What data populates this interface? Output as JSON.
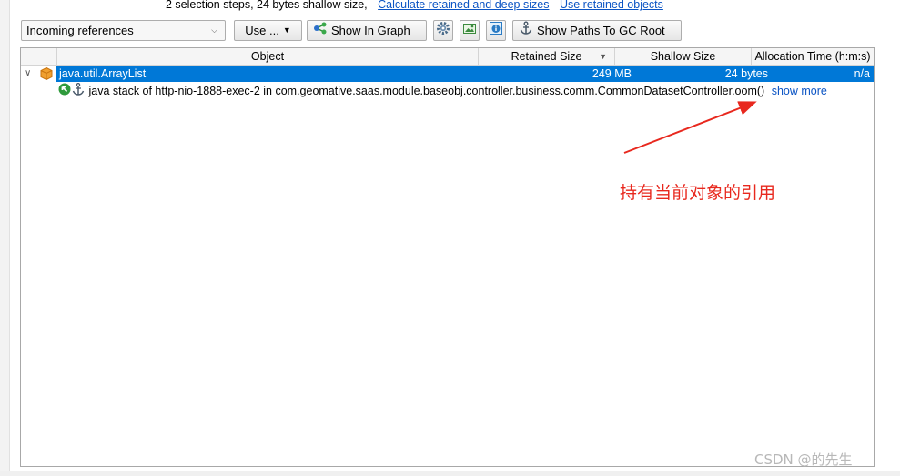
{
  "info": {
    "text": "2 selection steps, 24 bytes shallow size,",
    "link_retained": "Calculate retained and deep sizes",
    "link_objects": "Use retained objects"
  },
  "toolbar": {
    "combo_value": "Incoming references",
    "use_label": "Use ...",
    "graph_label": "Show In Graph",
    "gc_label": "Show Paths To GC Root"
  },
  "table": {
    "columns": {
      "object": "Object",
      "retained": "Retained Size",
      "shallow": "Shallow Size",
      "alloc": "Allocation Time (h:m:s)"
    },
    "root_row": {
      "name": "java.util.ArrayList",
      "retained": "249 MB",
      "shallow": "24 bytes",
      "alloc": "n/a"
    },
    "child_row": {
      "text": "java stack of http-nio-1888-exec-2 in com.geomative.saas.module.baseobj.controller.business.comm.CommonDatasetController.oom()",
      "link": "show more"
    }
  },
  "annotation": {
    "text": "持有当前对象的引用",
    "color": "#e8281e"
  },
  "watermark": {
    "text": "CSDN @的先生"
  },
  "colors": {
    "selection": "#0078d7",
    "link": "#0b54c4"
  }
}
